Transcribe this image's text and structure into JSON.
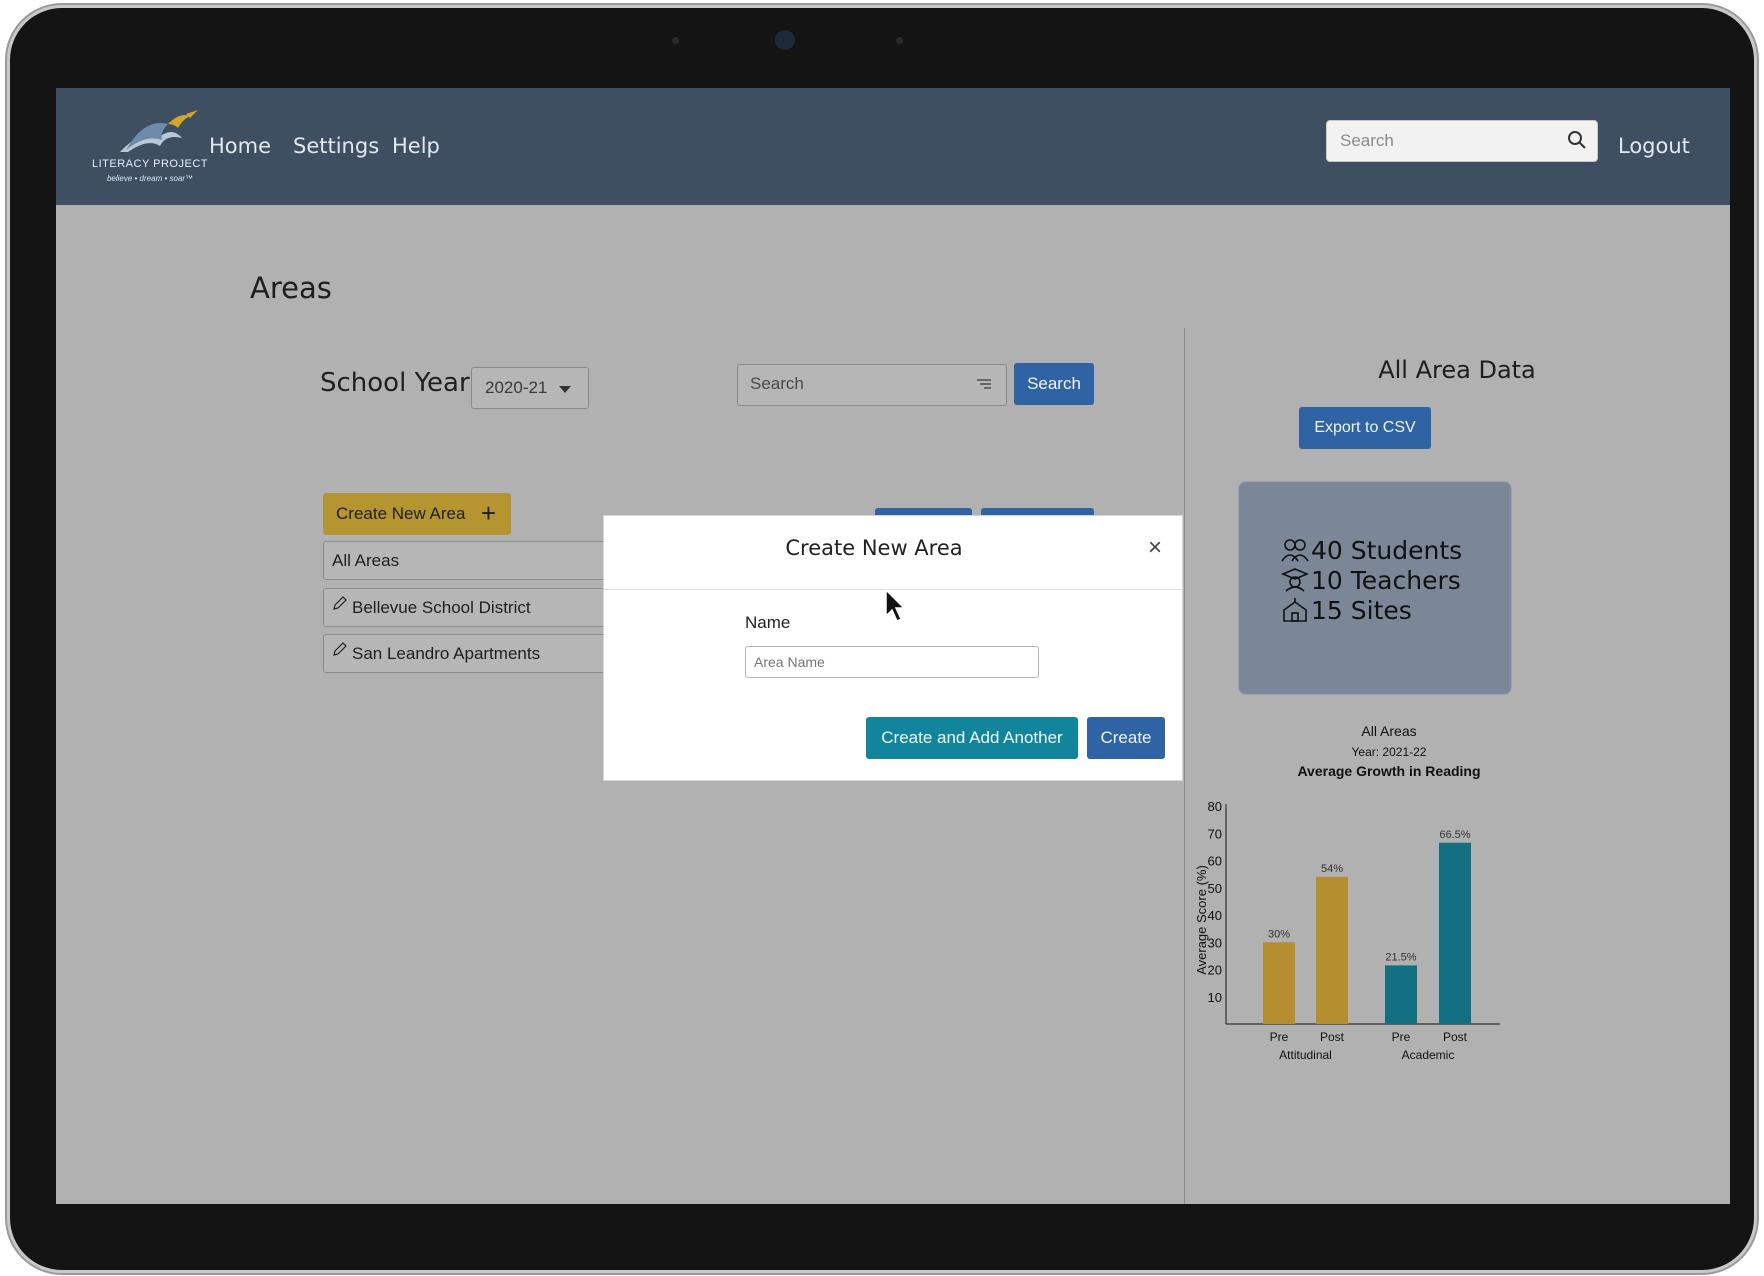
{
  "nav": {
    "logo_text": "LITERACY PROJECT",
    "logo_tagline": "believe • dream • soar™",
    "links": [
      "Home",
      "Settings",
      "Help"
    ],
    "search_placeholder": "Search",
    "logout": "Logout"
  },
  "page": {
    "title": "Areas",
    "school_year_label": "School Year",
    "school_year_value": "2020-21",
    "search_placeholder": "Search",
    "search_button": "Search",
    "create_button": "Create New Area",
    "areas": [
      "All Areas",
      "Bellevue School District",
      "San Leandro Apartments"
    ]
  },
  "modal": {
    "title": "Create New Area",
    "close": "×",
    "name_label": "Name",
    "name_placeholder": "Area Name",
    "create_another": "Create and Add Another",
    "create": "Create"
  },
  "right_panel": {
    "title": "All Area Data",
    "export": "Export to CSV",
    "stats": {
      "students": "40 Students",
      "teachers": "10 Teachers",
      "sites": "15 Sites"
    }
  },
  "colors": {
    "nav": "#3d4f61",
    "gold": "#b4952f",
    "teal": "#12859c",
    "blue": "#2f63a3",
    "bar_gold": "#b58f2f",
    "bar_teal": "#136f82"
  },
  "chart_data": {
    "type": "bar",
    "title": "Average Growth in Reading",
    "pretitle": "All Areas",
    "subtitle": "Year: 2021-22",
    "ylabel": "Average Score (%)",
    "ylim": [
      0,
      80
    ],
    "yticks": [
      10,
      20,
      30,
      40,
      50,
      60,
      70,
      80
    ],
    "groups": [
      {
        "name": "Attitudinal",
        "bars": [
          {
            "label": "Pre",
            "value": 30,
            "text": "30%"
          },
          {
            "label": "Post",
            "value": 54,
            "text": "54%"
          }
        ],
        "color": "#b58f2f"
      },
      {
        "name": "Academic",
        "bars": [
          {
            "label": "Pre",
            "value": 21.5,
            "text": "21.5%"
          },
          {
            "label": "Post",
            "value": 66.5,
            "text": "66.5%"
          }
        ],
        "color": "#136f82"
      }
    ]
  }
}
